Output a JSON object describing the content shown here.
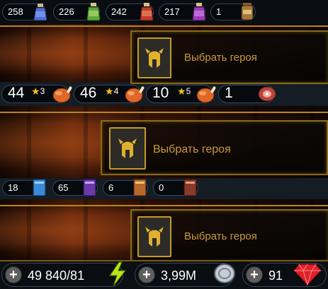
{
  "top_counters": [
    {
      "value": "258",
      "icon": "blue-potion-icon"
    },
    {
      "value": "226",
      "icon": "green-potion-icon"
    },
    {
      "value": "242",
      "icon": "red-potion-icon"
    },
    {
      "value": "217",
      "icon": "purple-potion-icon"
    },
    {
      "value": "1",
      "icon": "jar-icon"
    }
  ],
  "hero_select": {
    "label": "Выбрать героя",
    "slot_icon": "helmet-icon"
  },
  "food_counters": [
    {
      "value": "44",
      "stars": "3",
      "icon": "roast-chicken-icon"
    },
    {
      "value": "46",
      "stars": "4",
      "icon": "roast-chicken-icon"
    },
    {
      "value": "10",
      "stars": "5",
      "icon": "roast-chicken-icon"
    },
    {
      "value": "1",
      "stars": "",
      "icon": "ham-icon"
    }
  ],
  "book_counters": [
    {
      "value": "18",
      "icon": "blue-book-icon"
    },
    {
      "value": "65",
      "icon": "purple-book-icon"
    },
    {
      "value": "6",
      "icon": "orange-book-icon"
    },
    {
      "value": "0",
      "icon": "red-book-icon"
    }
  ],
  "resources": [
    {
      "value": "49 840/81",
      "icon": "lightning-icon"
    },
    {
      "value": "3,99M",
      "icon": "silver-coin-icon"
    },
    {
      "value": "91",
      "icon": "ruby-icon"
    }
  ],
  "colors": {
    "gold": "#c79a3a",
    "accent_border": "#b9861e",
    "star": "#f2c21a"
  }
}
